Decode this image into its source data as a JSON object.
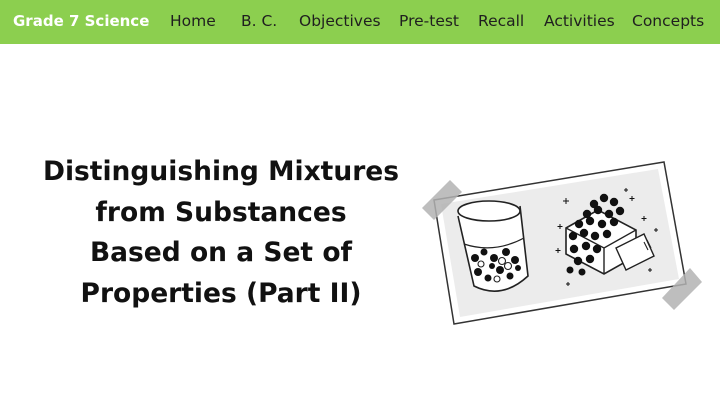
{
  "header": {
    "brand": "Grade 7 Science",
    "nav": [
      "Home",
      "B. C.",
      "Objectives",
      "Pre-test",
      "Recall",
      "Activities",
      "Concepts"
    ]
  },
  "main": {
    "title_lines": [
      "Distinguishing Mixtures",
      "from Substances",
      "Based on a Set of",
      "Properties (Part II)"
    ]
  },
  "colors": {
    "header_bg": "#8ccf4f",
    "brand_text": "#ffffff",
    "nav_text": "#1f1f1f",
    "title_text": "#111111"
  },
  "icons": {
    "illustration": "taped-photo-beaker-and-crystal"
  }
}
